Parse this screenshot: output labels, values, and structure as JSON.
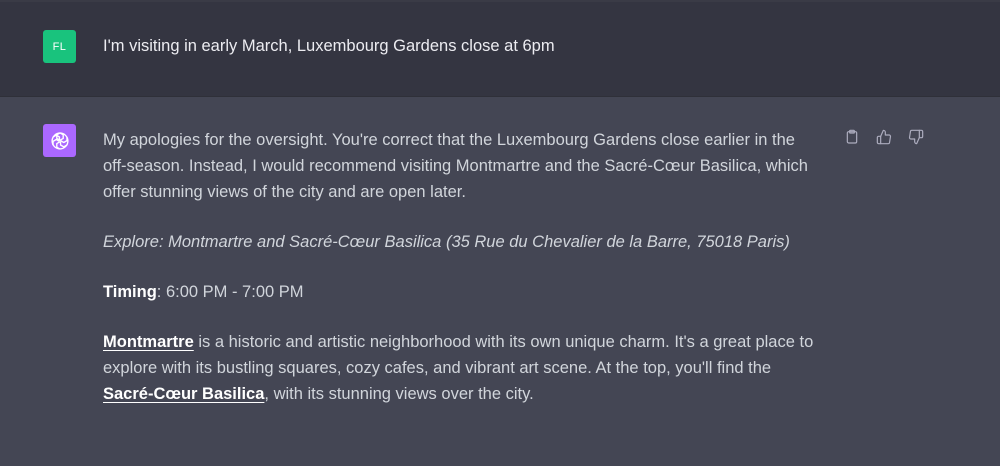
{
  "user_message": {
    "avatar_initials": "FL",
    "avatar_color": "#19c37d",
    "text": "I'm visiting in early March, Luxembourg Gardens close at 6pm"
  },
  "assistant_message": {
    "avatar_icon": "openai-logo-icon",
    "avatar_color": "#ab68ff",
    "paragraph1": "My apologies for the oversight. You're correct that the Luxembourg Gardens close earlier in the off-season. Instead, I would recommend visiting Montmartre and the Sacré-Cœur Basilica, which offer stunning views of the city and are open later.",
    "explore": "Explore: Montmartre and Sacré-Cœur Basilica (35 Rue du Chevalier de la Barre, 75018 Paris)",
    "timing_label": "Timing",
    "timing_value": ": 6:00 PM - 7:00 PM",
    "montmartre_link": "Montmartre",
    "paragraph4_part1": " is a historic and artistic neighborhood with its own unique charm. It's a great place to explore with its bustling squares, cozy cafes, and vibrant art scene. At the top, you'll find the ",
    "basilica_link": "Sacré-Cœur Basilica",
    "paragraph4_part2": ", with its stunning views over the city."
  },
  "actions": {
    "icons": [
      "clipboard-icon",
      "thumbs-up-icon",
      "thumbs-down-icon"
    ]
  },
  "colors": {
    "user_bg": "#343541",
    "assistant_bg": "#444654",
    "text": "#d1d5db"
  }
}
